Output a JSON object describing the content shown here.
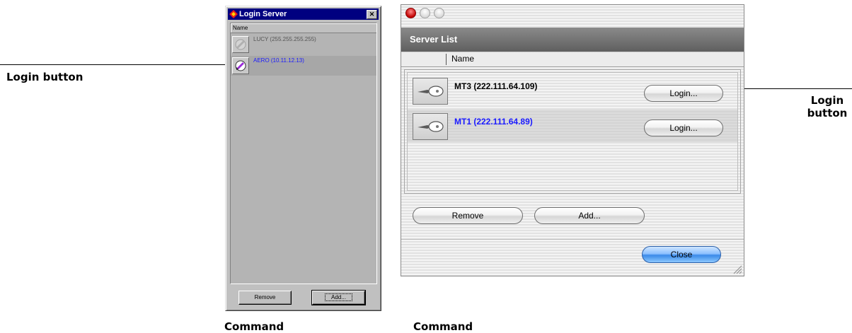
{
  "annotations": {
    "left_label": "Login button",
    "right_label_line1": "Login",
    "right_label_line2": "button",
    "bottom_left": "Command",
    "bottom_right": "Command"
  },
  "win_dialog": {
    "title": "Login Server",
    "close_glyph": "✕",
    "column_header": "Name",
    "rows": [
      {
        "text": "LUCY (255.255.255.255)",
        "color": "#555555",
        "icon": "disconnect-icon",
        "selected": false
      },
      {
        "text": "AERO (10.11.12.13)",
        "color": "#1a1aff",
        "icon": "login-icon",
        "selected": true
      }
    ],
    "remove_label": "Remove",
    "add_label": "Add..."
  },
  "mac_dialog": {
    "header": "Server List",
    "column_header": "Name",
    "rows": [
      {
        "text": "MT3 (222.111.64.109)",
        "login_label": "Login...",
        "icon": "key-icon",
        "color": "#000000"
      },
      {
        "text": "MT1 (222.111.64.89)",
        "login_label": "Login...",
        "icon": "key-icon",
        "color": "#1a1aff"
      }
    ],
    "remove_label": "Remove",
    "add_label": "Add...",
    "close_label": "Close"
  }
}
